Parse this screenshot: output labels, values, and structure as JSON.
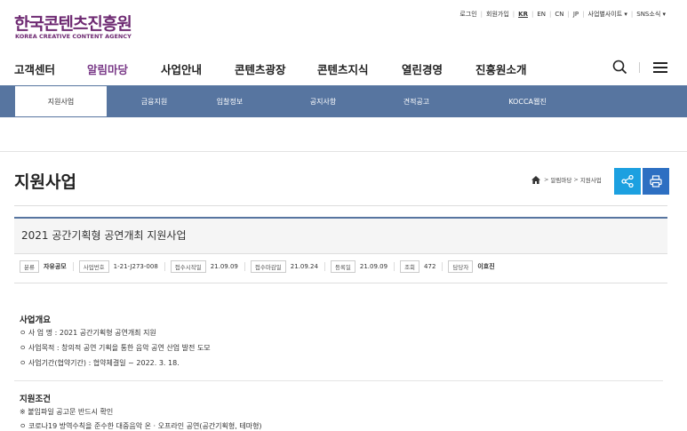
{
  "header": {
    "logo_ko": "한국콘텐츠진흥원",
    "logo_en": "KOREA CREATIVE CONTENT AGENCY",
    "util_links": [
      "로그인",
      "회원가입",
      "KR",
      "EN",
      "CN",
      "JP",
      "사업별사이트 ▾",
      "SNS소식 ▾"
    ]
  },
  "gnb": {
    "items": [
      "고객센터",
      "알림마당",
      "사업안내",
      "콘텐츠광장",
      "콘텐츠지식",
      "열린경영",
      "진흥원소개"
    ],
    "active_index": 1
  },
  "subnav": {
    "tabs": [
      "지원사업",
      "금융지원",
      "입찰정보",
      "공지사항",
      "견적공고",
      "KOCCA웹진"
    ],
    "active_index": 0
  },
  "page": {
    "title": "지원사업",
    "breadcrumb": [
      "알림마당",
      "지원사업"
    ]
  },
  "article": {
    "title": "2021 공간기획형 공연개최 지원사업",
    "meta": [
      {
        "label": "분류",
        "value": "자유공모"
      },
      {
        "label": "사업번호",
        "value": "1-21-J273-008"
      },
      {
        "label": "접수시작일",
        "value": "21.09.09"
      },
      {
        "label": "접수마감일",
        "value": "21.09.24"
      },
      {
        "label": "등록일",
        "value": "21.09.09"
      },
      {
        "label": "조회",
        "value": "472"
      },
      {
        "label": "담당자",
        "value": "이효진"
      }
    ]
  },
  "content": {
    "section1": {
      "heading": "사업개요",
      "lines": [
        "ㅇ 사 업 명 : 2021 공간기획형 공연개최 지원",
        "ㅇ 사업목적 : 창의적 공연 기획을 통한 음악 공연 산업 발전 도모",
        "ㅇ 사업기간(협약기간) : 협약체결일 ~ 2022. 3. 18."
      ]
    },
    "section2": {
      "heading": "지원조건",
      "lines": [
        "※ 붙임파일 공고문 반드시 확인",
        "ㅇ 코로나19 방역수칙을 준수한 대중음악 온 · 오프라인 공연(공간기획형, 테마형)"
      ]
    }
  },
  "colors": {
    "brand": "#6e2a72",
    "subnav": "#5775a0",
    "share": "#1ca0e0",
    "print": "#2d6fc2"
  }
}
